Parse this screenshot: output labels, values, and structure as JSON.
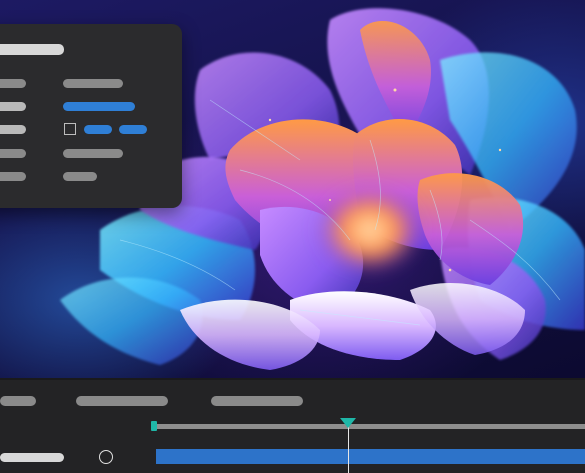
{
  "artwork": {
    "icon": "abstract-flower-artwork",
    "colors": {
      "background": "#14124a",
      "petal_orange": "#ff8a3d",
      "petal_violet": "#b46cff",
      "petal_cyan": "#35d7ff",
      "petal_white": "#f4e9ff"
    }
  },
  "properties_panel": {
    "rows": 5,
    "colors": {
      "background": "#2b2b2d",
      "accent": "#2f7fd6",
      "label": "#d8d8d8",
      "value": "#8a8a8a"
    }
  },
  "timeline": {
    "colors": {
      "background": "#232325",
      "track": "#8e8e8e",
      "clip": "#2d73c9",
      "playhead": "#1fb7a8"
    }
  }
}
